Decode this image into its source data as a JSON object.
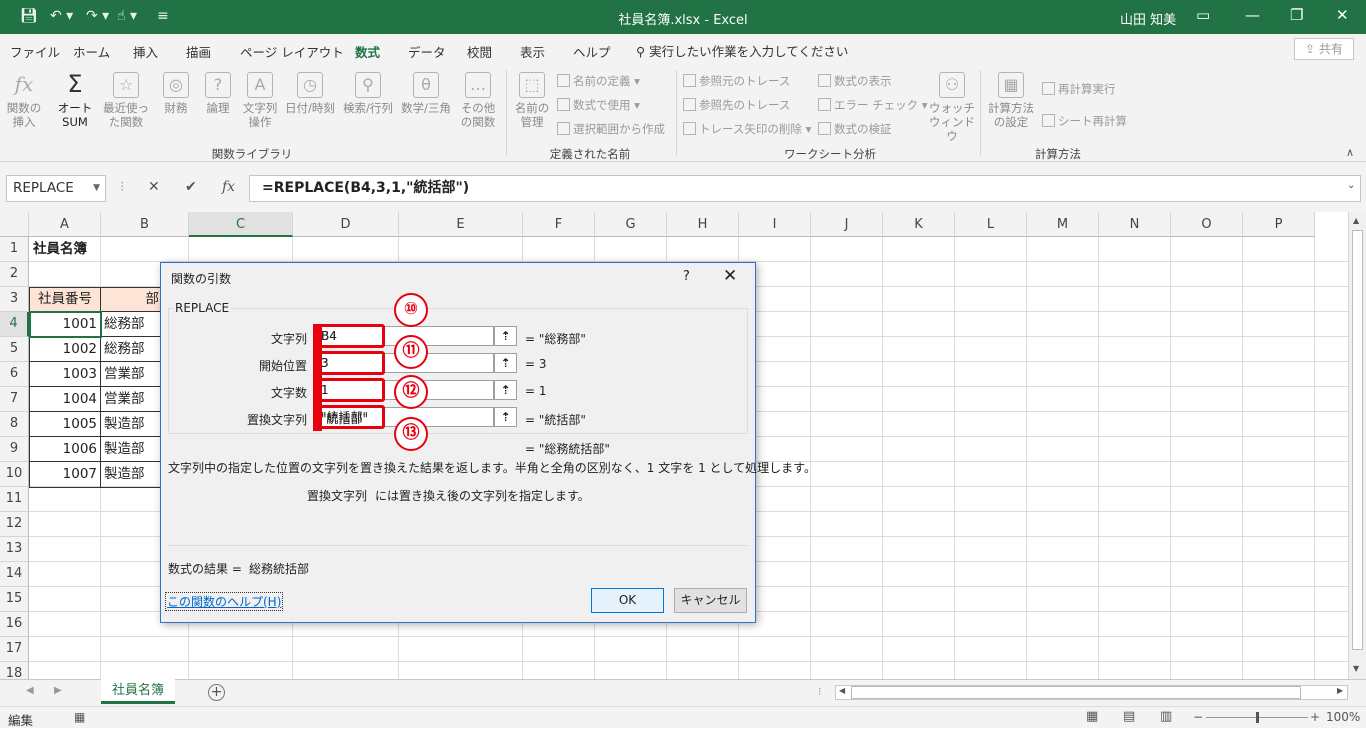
{
  "titlebar": {
    "title": "社員名簿.xlsx  -  Excel",
    "user": "山田 知美"
  },
  "tabs": [
    "ファイル",
    "ホーム",
    "挿入",
    "描画",
    "ページ レイアウト",
    "数式",
    "データ",
    "校閲",
    "表示",
    "ヘルプ"
  ],
  "active_tab": "数式",
  "tellme": "実行したい作業を入力してください",
  "share": "共有",
  "ribbon": {
    "insert_function": "関数の挿入",
    "autosum": "オート SUM",
    "recent": "最近使った関数",
    "financial": "財務",
    "logical": "論理",
    "text": "文字列操作",
    "datetime": "日付/時刻",
    "lookup": "検索/行列",
    "math": "数学/三角",
    "more": "その他の関数",
    "group_lib": "関数ライブラリ",
    "name_mgr": "名前の管理",
    "define_name": "名前の定義",
    "use_in_formula": "数式で使用",
    "create_from_sel": "選択範囲から作成",
    "group_names": "定義された名前",
    "trace_prec": "参照元のトレース",
    "trace_dep": "参照先のトレース",
    "remove_arrows": "トレース矢印の削除",
    "show_formulas": "数式の表示",
    "error_check": "エラー チェック",
    "evaluate": "数式の検証",
    "watch": "ウォッチ ウィンドウ",
    "group_audit": "ワークシート分析",
    "calc_options": "計算方法の設定",
    "calc_now": "再計算実行",
    "calc_sheet": "シート再計算",
    "group_calc": "計算方法"
  },
  "namebox": "REPLACE",
  "formula": "=REPLACE(B4,3,1,\"統括部\")",
  "columns": [
    "A",
    "B",
    "C",
    "D",
    "E",
    "F",
    "G",
    "H",
    "I",
    "J",
    "K",
    "L",
    "M",
    "N",
    "O",
    "P"
  ],
  "rows": [
    "1",
    "2",
    "3",
    "4",
    "5",
    "6",
    "7",
    "8",
    "9",
    "10",
    "11",
    "12",
    "13",
    "14",
    "15",
    "16",
    "17",
    "18"
  ],
  "sheet": {
    "title": "社員名簿",
    "header_a": "社員番号",
    "header_b": "部",
    "ids": [
      "1001",
      "1002",
      "1003",
      "1004",
      "1005",
      "1006",
      "1007"
    ],
    "depts": [
      "総務部",
      "総務部",
      "営業部",
      "営業部",
      "製造部",
      "製造部",
      "製造部"
    ]
  },
  "sheet_tab": "社員名簿",
  "status": "編集",
  "zoom": "100%",
  "dialog": {
    "title": "関数の引数",
    "help_q": "?",
    "close": "✕",
    "function_name": "REPLACE",
    "args": [
      {
        "label": "文字列",
        "value": "B4",
        "result": "= \"総務部\"",
        "badge": "⑩"
      },
      {
        "label": "開始位置",
        "value": "3",
        "result": "= 3",
        "badge": "⑪"
      },
      {
        "label": "文字数",
        "value": "1",
        "result": "= 1",
        "badge": "⑫"
      },
      {
        "label": "置換文字列",
        "value": "\"統括部\"",
        "result": "= \"統括部\"",
        "badge": "⑬"
      }
    ],
    "overall_result": "= \"総務統括部\"",
    "description": "文字列中の指定した位置の文字列を置き換えた結果を返します。半角と全角の区別なく、1 文字を 1 として処理します。",
    "arg_help_name": "置換文字列",
    "arg_help_text": "には置き換え後の文字列を指定します。",
    "formula_result_label": "数式の結果 =",
    "formula_result_value": "総務統括部",
    "help_link": "この関数のヘルプ(H)",
    "ok": "OK",
    "cancel": "キャンセル"
  }
}
